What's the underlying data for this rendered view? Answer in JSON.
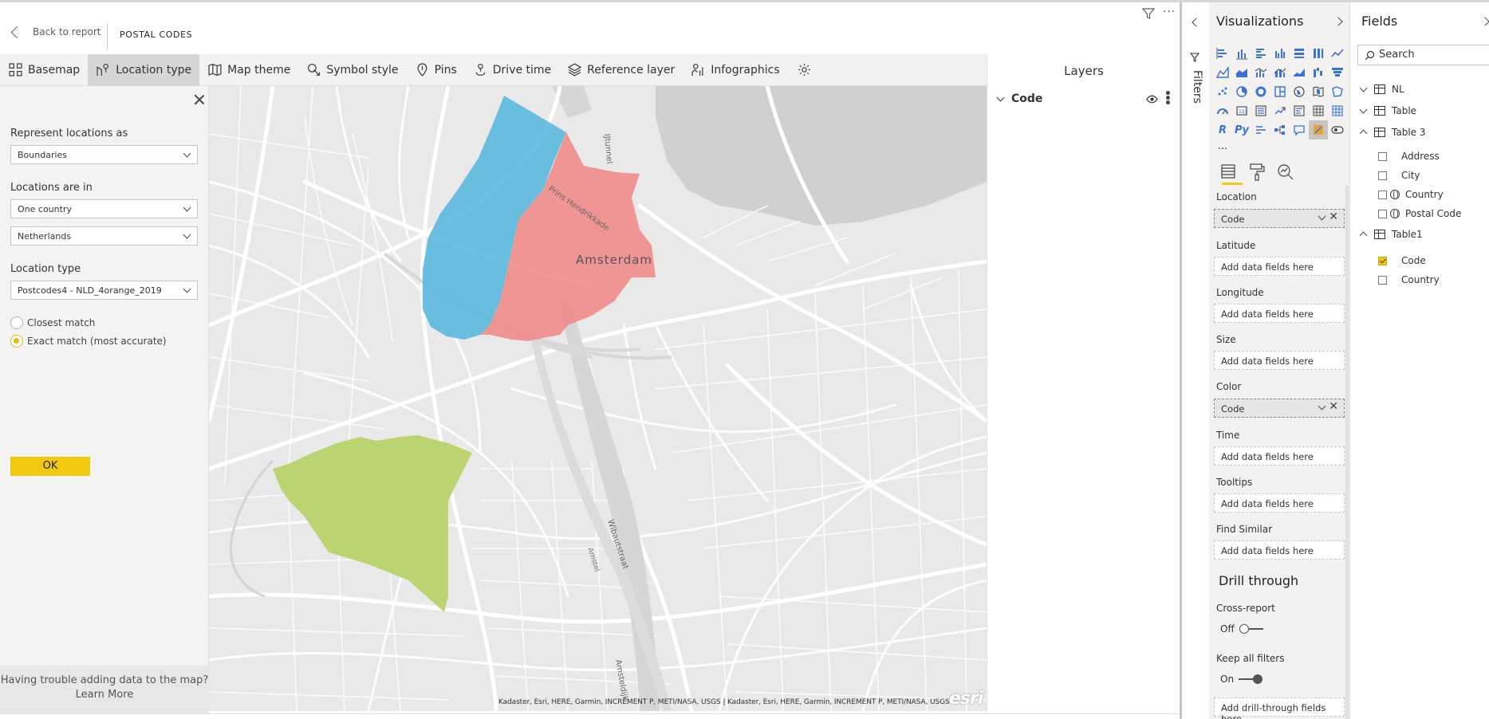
{
  "header": {
    "back_label": "Back to report",
    "page_title": "POSTAL CODES",
    "more_label": "···"
  },
  "toolbar": {
    "items": [
      {
        "label": "Basemap",
        "icon": "basemap-grid-icon"
      },
      {
        "label": "Location type",
        "icon": "location-type-icon",
        "active": true
      },
      {
        "label": "Map theme",
        "icon": "map-theme-icon"
      },
      {
        "label": "Symbol style",
        "icon": "symbol-style-icon"
      },
      {
        "label": "Pins",
        "icon": "pin-icon"
      },
      {
        "label": "Drive time",
        "icon": "drive-time-icon"
      },
      {
        "label": "Reference layer",
        "icon": "layers-icon"
      },
      {
        "label": "Infographics",
        "icon": "infographics-icon"
      }
    ],
    "settings_icon": "gear-icon"
  },
  "settings": {
    "represent_label": "Represent locations as",
    "represent_value": "Boundaries",
    "locations_in_label": "Locations are in",
    "locations_in_value": "One country",
    "country_value": "Netherlands",
    "location_type_label": "Location type",
    "location_type_value": "Postcodes4 - NLD_4orange_2019",
    "closest_match_label": "Closest match",
    "exact_match_label": "Exact match (most accurate)",
    "selected_match": "Exact match (most accurate)",
    "ok_label": "OK",
    "trouble_text": "Having trouble adding data to the map?",
    "learn_more": "Learn More"
  },
  "map": {
    "city_label": "Amsterdam",
    "street_labels": [
      "Prins Hendrikkade",
      "IJtunnel",
      "Wibautstraat",
      "Amstel",
      "Amsteldijk"
    ],
    "attribution": "Kadaster, Esri, HERE, Garmin, INCREMENT P, METI/NASA, USGS | Kadaster, Esri, HERE, Garmin, INCREMENT P, METI/NASA, USGS",
    "esri_logo": "esri",
    "colors": {
      "blue": "#5bb8de",
      "red": "#f08d8c",
      "green": "#b8d36a",
      "base": "#e9e9e9",
      "road": "#ffffff",
      "water": "#cfcfcf"
    }
  },
  "layers": {
    "title": "Layers",
    "items": [
      {
        "label": "Code",
        "visible": true
      }
    ]
  },
  "filters": {
    "label": "Filters"
  },
  "visualizations": {
    "title": "Visualizations",
    "extra_labels": [
      "R",
      "Py",
      "···"
    ],
    "wells": [
      {
        "label": "Location",
        "value": "Code",
        "filled": true
      },
      {
        "label": "Latitude",
        "value": "Add data fields here"
      },
      {
        "label": "Longitude",
        "value": "Add data fields here"
      },
      {
        "label": "Size",
        "value": "Add data fields here"
      },
      {
        "label": "Color",
        "value": "Code",
        "filled": true
      },
      {
        "label": "Time",
        "value": "Add data fields here"
      },
      {
        "label": "Tooltips",
        "value": "Add data fields here"
      },
      {
        "label": "Find Similar",
        "value": "Add data fields here"
      }
    ],
    "drill_title": "Drill through",
    "cross_report_label": "Cross-report",
    "cross_report_state": "Off",
    "keep_filters_label": "Keep all filters",
    "keep_filters_state": "On",
    "drill_well": "Add drill-through fields here"
  },
  "fields": {
    "title": "Fields",
    "search_placeholder": "Search",
    "tables": [
      {
        "name": "NL",
        "expanded": false
      },
      {
        "name": "Table",
        "expanded": false
      },
      {
        "name": "Table 3",
        "expanded": true,
        "fields": [
          {
            "name": "Address",
            "checked": false
          },
          {
            "name": "City",
            "checked": false
          },
          {
            "name": "Country",
            "checked": false,
            "geo": true
          },
          {
            "name": "Postal Code",
            "checked": false,
            "geo": true
          }
        ]
      },
      {
        "name": "Table1",
        "expanded": true,
        "fields": [
          {
            "name": "Code",
            "checked": true
          },
          {
            "name": "Country",
            "checked": false
          }
        ]
      }
    ]
  }
}
